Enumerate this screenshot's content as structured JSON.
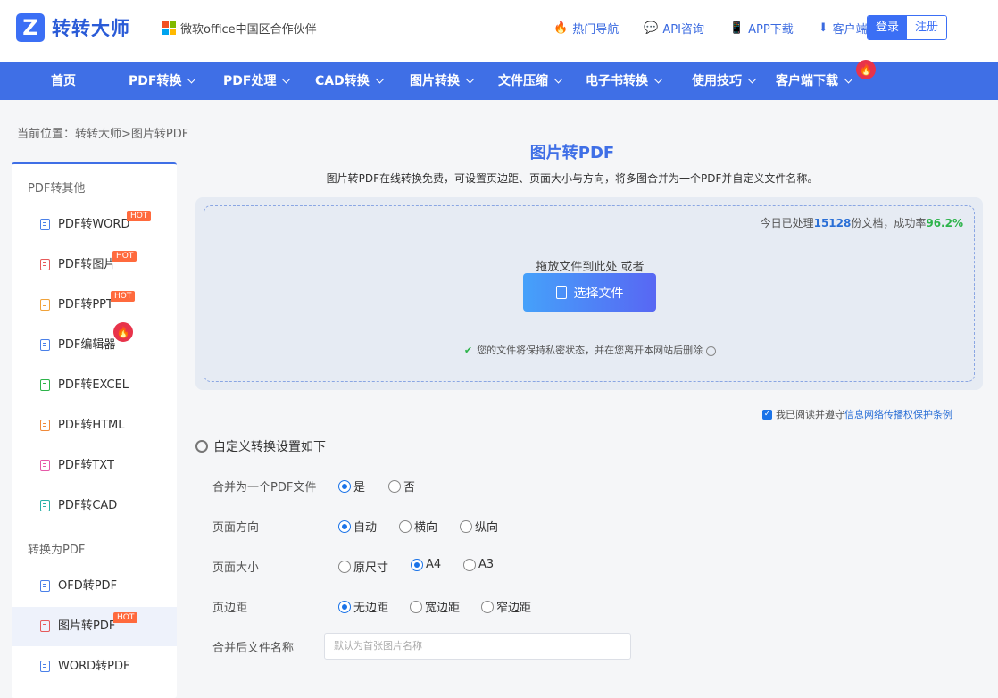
{
  "header": {
    "logo_mark": "Z",
    "logo_text": "转转大师",
    "partner": "微软office中国区合作伙伴",
    "links": [
      {
        "icon": "fire-icon",
        "label": "热门导航"
      },
      {
        "icon": "chat-icon",
        "label": "API咨询"
      },
      {
        "icon": "phone-icon",
        "label": "APP下载"
      },
      {
        "icon": "download-icon",
        "label": "客户端"
      }
    ],
    "login": "登录",
    "register": "注册"
  },
  "nav": {
    "items": [
      "首页",
      "PDF转换",
      "PDF处理",
      "CAD转换",
      "图片转换",
      "文件压缩",
      "电子书转换",
      "使用技巧",
      "客户端下载"
    ]
  },
  "breadcrumb": "当前位置：转转大师>图片转PDF",
  "sidebar": {
    "section1": "PDF转其他",
    "items1": [
      {
        "label": "PDF转WORD",
        "badge": "HOT",
        "color": "#4a80e8"
      },
      {
        "label": "PDF转图片",
        "badge": "HOT",
        "color": "#e65a5a"
      },
      {
        "label": "PDF转PPT",
        "badge": "HOT",
        "color": "#f0a23a"
      },
      {
        "label": "PDF编辑器",
        "badge": "fire",
        "color": "#4a80e8"
      },
      {
        "label": "PDF转EXCEL",
        "badge": "",
        "color": "#2db34a"
      },
      {
        "label": "PDF转HTML",
        "badge": "",
        "color": "#f08a3a"
      },
      {
        "label": "PDF转TXT",
        "badge": "",
        "color": "#e659a8"
      },
      {
        "label": "PDF转CAD",
        "badge": "",
        "color": "#2ab0a8"
      }
    ],
    "section2": "转换为PDF",
    "items2": [
      {
        "label": "OFD转PDF",
        "badge": "",
        "color": "#4a80e8"
      },
      {
        "label": "图片转PDF",
        "badge": "HOT",
        "color": "#e65a5a"
      },
      {
        "label": "WORD转PDF",
        "badge": "",
        "color": "#4a80e8"
      }
    ]
  },
  "main": {
    "title": "图片转PDF",
    "description": "图片转PDF在线转换免费，可设置页边距、页面大小与方向，将多图合并为一个PDF并自定义文件名称。",
    "stats_prefix": "今日已处理",
    "stats_count": "15128",
    "stats_mid": "份文档，成功率",
    "stats_rate": "96.2%",
    "drop_text": "拖放文件到此处 或者",
    "choose_button": "选择文件",
    "privacy": "您的文件将保持私密状态，并在您离开本网站后删除",
    "agree_prefix": "我已阅读并遵守",
    "agree_link": "信息网络传播权保护条例",
    "settings_title": "自定义转换设置如下"
  },
  "options": {
    "merge": {
      "label": "合并为一个PDF文件",
      "choices": [
        "是",
        "否"
      ],
      "selected": "是"
    },
    "orientation": {
      "label": "页面方向",
      "choices": [
        "自动",
        "横向",
        "纵向"
      ],
      "selected": "自动"
    },
    "size": {
      "label": "页面大小",
      "choices": [
        "原尺寸",
        "A4",
        "A3"
      ],
      "selected": "A4"
    },
    "margin": {
      "label": "页边距",
      "choices": [
        "无边距",
        "宽边距",
        "窄边距"
      ],
      "selected": "无边距"
    },
    "filename": {
      "label": "合并后文件名称",
      "placeholder": "默认为首张图片名称"
    }
  },
  "colors": {
    "accent": "#3f6fe6",
    "hot": "#ff6a3d",
    "success": "#2db34a"
  }
}
